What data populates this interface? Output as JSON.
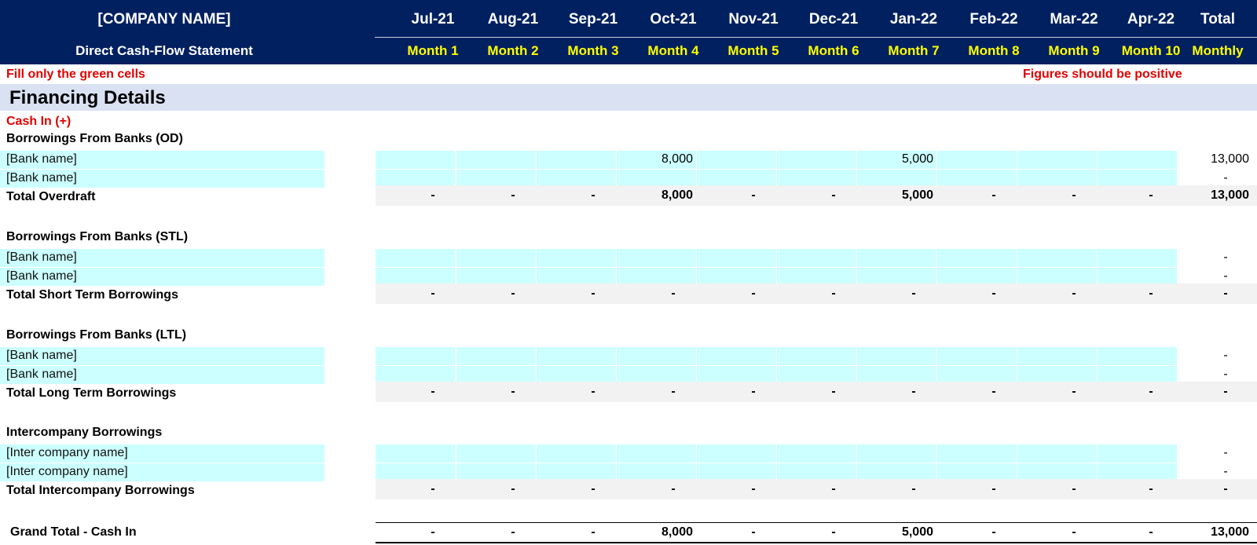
{
  "header": {
    "company": "[COMPANY NAME]",
    "statement": "Direct Cash-Flow Statement",
    "months": [
      "Jul-21",
      "Aug-21",
      "Sep-21",
      "Oct-21",
      "Nov-21",
      "Dec-21",
      "Jan-22",
      "Feb-22",
      "Mar-22",
      "Apr-22"
    ],
    "month_labels": [
      "Month 1",
      "Month 2",
      "Month 3",
      "Month 4",
      "Month 5",
      "Month 6",
      "Month 7",
      "Month 8",
      "Month 9",
      "Month 10"
    ],
    "total_label": "Total",
    "total_sub": "Monthly"
  },
  "notes": {
    "left": "Fill only the green cells",
    "right": "Figures should be positive"
  },
  "section": {
    "title": "Financing Details",
    "cash_in": "Cash In (+)"
  },
  "groups": [
    {
      "title": "Borrowings From Banks (OD)",
      "rows": [
        {
          "label": "[Bank name]",
          "values": [
            "",
            "",
            "",
            "8,000",
            "",
            "",
            "5,000",
            "",
            "",
            ""
          ],
          "total": "13,000"
        },
        {
          "label": "[Bank name]",
          "values": [
            "",
            "",
            "",
            "",
            "",
            "",
            "",
            "",
            "",
            ""
          ],
          "total": "-"
        }
      ],
      "total_label": "Total Overdraft",
      "total_values": [
        "-",
        "-",
        "-",
        "8,000",
        "-",
        "-",
        "5,000",
        "-",
        "-",
        "-"
      ],
      "total_total": "13,000"
    },
    {
      "title": "Borrowings From Banks (STL)",
      "rows": [
        {
          "label": "[Bank name]",
          "values": [
            "",
            "",
            "",
            "",
            "",
            "",
            "",
            "",
            "",
            ""
          ],
          "total": "-"
        },
        {
          "label": "[Bank name]",
          "values": [
            "",
            "",
            "",
            "",
            "",
            "",
            "",
            "",
            "",
            ""
          ],
          "total": "-"
        }
      ],
      "total_label": "Total Short Term Borrowings",
      "total_values": [
        "-",
        "-",
        "-",
        "-",
        "-",
        "-",
        "-",
        "-",
        "-",
        "-"
      ],
      "total_total": "-"
    },
    {
      "title": "Borrowings From Banks (LTL)",
      "rows": [
        {
          "label": "[Bank name]",
          "values": [
            "",
            "",
            "",
            "",
            "",
            "",
            "",
            "",
            "",
            ""
          ],
          "total": "-"
        },
        {
          "label": "[Bank name]",
          "values": [
            "",
            "",
            "",
            "",
            "",
            "",
            "",
            "",
            "",
            ""
          ],
          "total": "-"
        }
      ],
      "total_label": "Total Long Term Borrowings",
      "total_values": [
        "-",
        "-",
        "-",
        "-",
        "-",
        "-",
        "-",
        "-",
        "-",
        "-"
      ],
      "total_total": "-"
    },
    {
      "title": "Intercompany Borrowings",
      "rows": [
        {
          "label": "[Inter company name]",
          "values": [
            "",
            "",
            "",
            "",
            "",
            "",
            "",
            "",
            "",
            ""
          ],
          "total": "-"
        },
        {
          "label": "[Inter company name]",
          "values": [
            "",
            "",
            "",
            "",
            "",
            "",
            "",
            "",
            "",
            ""
          ],
          "total": "-"
        }
      ],
      "total_label": "Total Intercompany Borrowings",
      "total_values": [
        "-",
        "-",
        "-",
        "-",
        "-",
        "-",
        "-",
        "-",
        "-",
        "-"
      ],
      "total_total": "-"
    }
  ],
  "grand_total": {
    "label": "Grand Total - Cash In",
    "values": [
      "-",
      "-",
      "-",
      "8,000",
      "-",
      "-",
      "5,000",
      "-",
      "-",
      "-"
    ],
    "total": "13,000"
  },
  "colors": {
    "header_bg": "#002060",
    "header_highlight": "#ffff00",
    "input_cell": "#ccffff",
    "section_band": "#d9e1f2",
    "total_band": "#f2f2f2",
    "note_red": "#e00000"
  }
}
